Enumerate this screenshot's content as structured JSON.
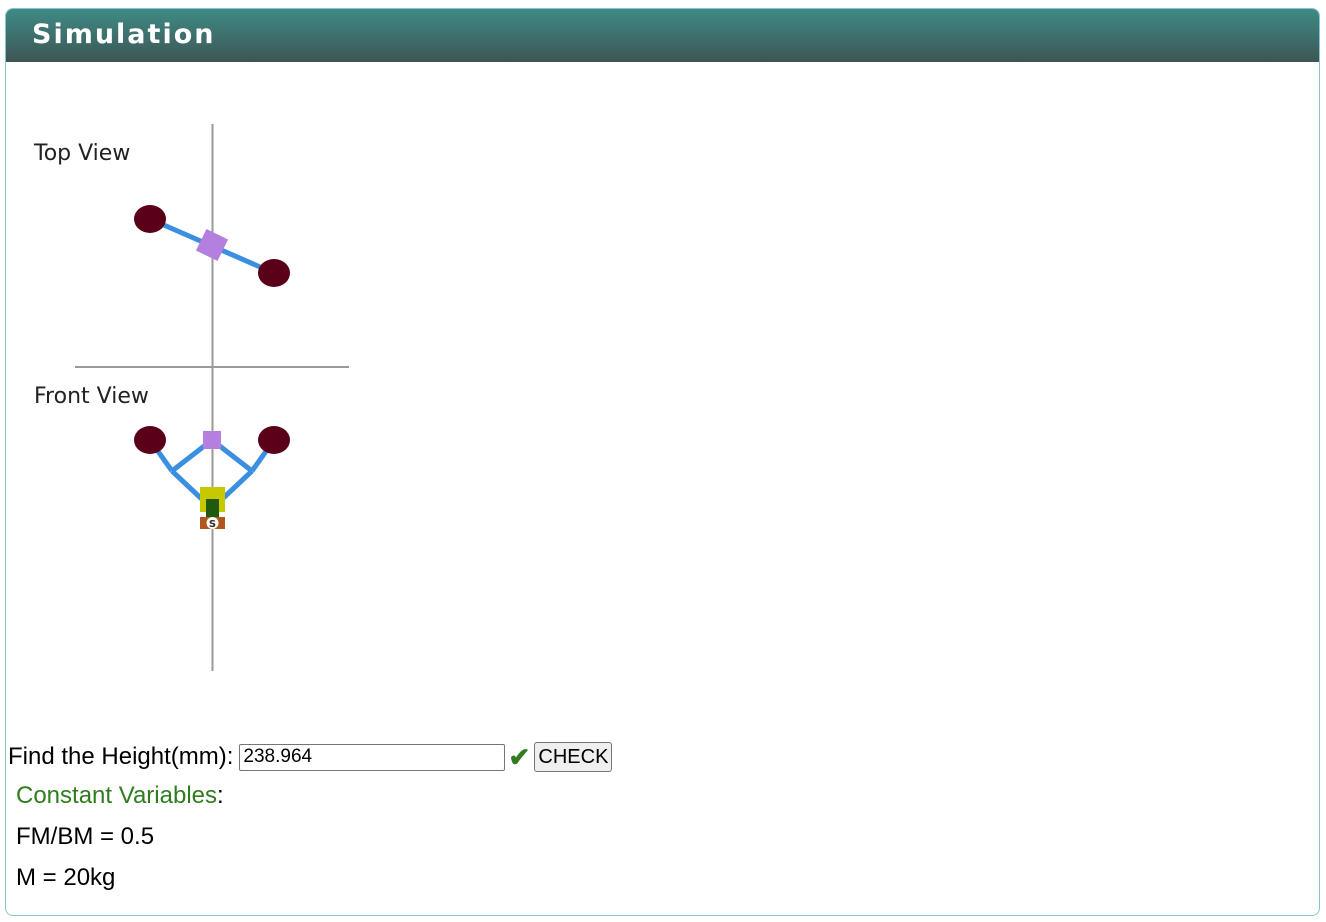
{
  "panel": {
    "title": "Simulation"
  },
  "simulation": {
    "top_view_label": "Top View",
    "front_view_label": "Front View",
    "colors": {
      "weight": "#5a0019",
      "arm": "#3b8fe0",
      "center": "#b57fe0",
      "axis": "#9a9a9a",
      "sleeve": "#c8c800",
      "spindle": "#1f5a0f",
      "base": "#b0561e"
    },
    "base_marker": "S"
  },
  "question": {
    "label": "Find the Height(mm):",
    "answer_value": "238.964",
    "check_icon": "check-icon",
    "check_button_label": "CHECK"
  },
  "constants": {
    "title": "Constant Variables",
    "colon": ":",
    "items": [
      "FM/BM = 0.5",
      "M = 20kg"
    ]
  }
}
